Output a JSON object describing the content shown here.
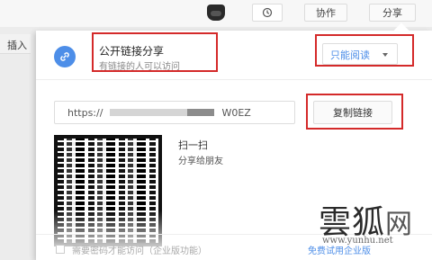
{
  "toolbar": {
    "collab_label": "协作",
    "share_label": "分享"
  },
  "left_panel": {
    "insert_label": "插入"
  },
  "share_panel": {
    "title": "公开链接分享",
    "subtitle": "有链接的人可以访问",
    "permission": {
      "selected": "只能阅读",
      "options": [
        "只能阅读"
      ]
    },
    "url": {
      "prefix": "https://",
      "suffix": "W0EZ"
    },
    "copy_label": "复制链接",
    "scan": {
      "title": "扫一扫",
      "subtitle": "分享给朋友"
    },
    "footer": {
      "password_label": "需要密码才能访问（企业版功能）",
      "trial_link": "免费试用企业版"
    }
  },
  "watermark": {
    "brand": "雲狐",
    "net": "网",
    "url": "www.yunhu.net"
  },
  "colors": {
    "accent": "#4d8ee8",
    "highlight_box": "#d42a2a"
  },
  "icons": [
    "history-icon",
    "link-icon",
    "chevron-down-icon",
    "avatar"
  ]
}
